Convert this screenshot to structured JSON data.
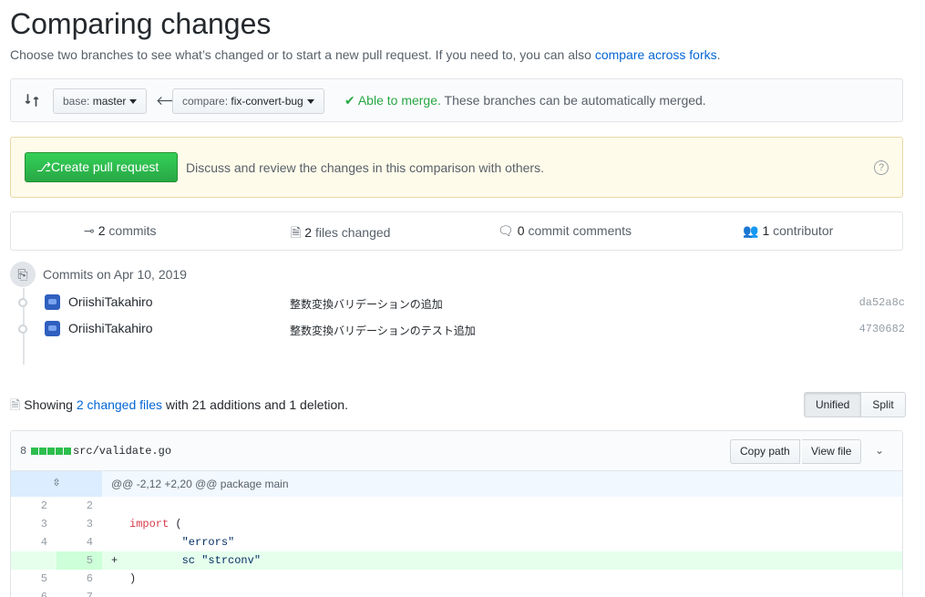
{
  "page": {
    "title": "Comparing changes",
    "subtitle_text": "Choose two branches to see what’s changed or to start a new pull request. If you need to, you can also ",
    "subtitle_link": "compare across forks",
    "subtitle_end": "."
  },
  "range": {
    "base_label": "base: ",
    "base_branch": "master",
    "compare_label": "compare: ",
    "compare_branch": "fix-convert-bug",
    "merge_ok": "✔ Able to merge.",
    "merge_text": " These branches can be automatically merged."
  },
  "pull_request": {
    "button_label": "Create pull request",
    "description": "Discuss and review the changes in this comparison with others."
  },
  "stats": {
    "commits_num": "2",
    "commits_label": " commits",
    "files_num": "2",
    "files_label": " files changed",
    "comments_num": "0",
    "comments_label": " commit comments",
    "contributors_num": "1",
    "contributors_label": " contributor"
  },
  "commits": {
    "date_heading": "Commits on Apr 10, 2019",
    "items": [
      {
        "author": "OriishiTakahiro",
        "message": "整数変換バリデーションの追加",
        "sha": "da52a8c"
      },
      {
        "author": "OriishiTakahiro",
        "message": "整数変換バリデーションのテスト追加",
        "sha": "4730682"
      }
    ]
  },
  "files_summary": {
    "prefix": "Showing ",
    "link": "2 changed files",
    "suffix": " with 21 additions and 1 deletion."
  },
  "view_toggle": {
    "unified": "Unified",
    "split": "Split",
    "selected": "Unified"
  },
  "file": {
    "diffstat_count": "8",
    "path": "src/validate.go",
    "copy_path": "Copy path",
    "view_file": "View file",
    "hunk_header": "@@ -2,12 +2,20 @@ package main",
    "lines": [
      {
        "old": "2",
        "new": "2",
        "marker": "",
        "code": ""
      },
      {
        "old": "3",
        "new": "3",
        "marker": "",
        "code_kw": "import",
        "code": " ("
      },
      {
        "old": "4",
        "new": "4",
        "marker": "",
        "code": "        \"errors\""
      },
      {
        "old": "",
        "new": "5",
        "marker": "+",
        "code": "        sc \"strconv\""
      },
      {
        "old": "5",
        "new": "6",
        "marker": "",
        "code": ")"
      },
      {
        "old": "6",
        "new": "7",
        "marker": "",
        "code": ""
      }
    ]
  },
  "colors": {
    "accent": "#0366d6",
    "success": "#28a745",
    "addition_bg": "#e6ffed"
  }
}
